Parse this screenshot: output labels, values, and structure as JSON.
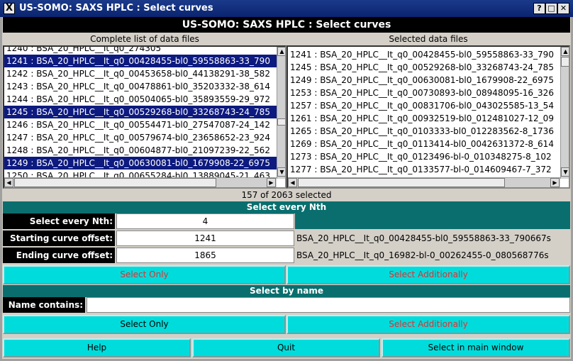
{
  "window": {
    "icon_glyph": "X",
    "title": "US-SOMO: SAXS HPLC : Select curves",
    "btn_help": "?",
    "btn_minimize": "_",
    "btn_maximize": "□",
    "btn_close": "✕"
  },
  "header": "US-SOMO: SAXS HPLC : Select curves",
  "left_list": {
    "label": "Complete list of data files",
    "items": [
      {
        "text": "1240 : BSA_20_HPLC__It_q0_274305",
        "selected": false
      },
      {
        "text": "1241 : BSA_20_HPLC__It_q0_00428455-bl0_59558863-33_790",
        "selected": true
      },
      {
        "text": "1242 : BSA_20_HPLC__It_q0_00453658-bl0_44138291-38_582",
        "selected": false
      },
      {
        "text": "1243 : BSA_20_HPLC__It_q0_00478861-bl0_35203332-38_614",
        "selected": false
      },
      {
        "text": "1244 : BSA_20_HPLC__It_q0_00504065-bl0_35893559-29_972",
        "selected": false
      },
      {
        "text": "1245 : BSA_20_HPLC__It_q0_00529268-bl0_33268743-24_785",
        "selected": true
      },
      {
        "text": "1246 : BSA_20_HPLC__It_q0_00554471-bl0_27547087-24_142",
        "selected": false
      },
      {
        "text": "1247 : BSA_20_HPLC__It_q0_00579674-bl0_23658652-23_924",
        "selected": false
      },
      {
        "text": "1248 : BSA_20_HPLC__It_q0_00604877-bl0_21097239-22_562",
        "selected": false
      },
      {
        "text": "1249 : BSA_20_HPLC__It_q0_00630081-bl0_1679908-22_6975",
        "selected": true
      },
      {
        "text": "1250 : BSA_20_HPLC__It_q0_00655284-bl0_13889045-21_463",
        "selected": false
      }
    ]
  },
  "right_list": {
    "label": "Selected data files",
    "items": [
      "1241 : BSA_20_HPLC__It_q0_00428455-bl0_59558863-33_790",
      "1245 : BSA_20_HPLC__It_q0_00529268-bl0_33268743-24_785",
      "1249 : BSA_20_HPLC__It_q0_00630081-bl0_1679908-22_6975",
      "1253 : BSA_20_HPLC__It_q0_00730893-bl0_08948095-16_326",
      "1257 : BSA_20_HPLC__It_q0_00831706-bl0_043025585-13_54",
      "1261 : BSA_20_HPLC__It_q0_00932519-bl0_012481027-12_09",
      "1265 : BSA_20_HPLC__It_q0_0103333-bl0_012283562-8_1736",
      "1269 : BSA_20_HPLC__It_q0_0113414-bl0_0042631372-8_614",
      "1273 : BSA_20_HPLC__It_q0_0123496-bl-0_010348275-8_102",
      "1277 : BSA_20_HPLC__It_q0_0133577-bl-0_014609467-7_372"
    ]
  },
  "status": "157 of 2063 selected",
  "select_nth": {
    "section_title": "Select every Nth",
    "nth_label": "Select every Nth:",
    "nth_value": "4",
    "start_label": "Starting curve offset:",
    "start_value": "1241",
    "start_name": "BSA_20_HPLC__It_q0_00428455-bl0_59558863-33_790667s",
    "end_label": "Ending curve offset:",
    "end_value": "1865",
    "end_name": "BSA_20_HPLC__It_q0_16982-bl-0_00262455-0_080568776s",
    "select_only": "Select Only",
    "select_additionally": "Select Additionally"
  },
  "select_name": {
    "section_title": "Select by name",
    "name_label": "Name contains:",
    "name_value": "",
    "select_only": "Select Only",
    "select_additionally": "Select Additionally"
  },
  "footer": {
    "help": "Help",
    "quit": "Quit",
    "select_main": "Select in main window"
  },
  "colors": {
    "selection": "#0d1a7f",
    "section": "#0a6e6e",
    "button": "#00dcdc",
    "red_text": "#e23030"
  }
}
